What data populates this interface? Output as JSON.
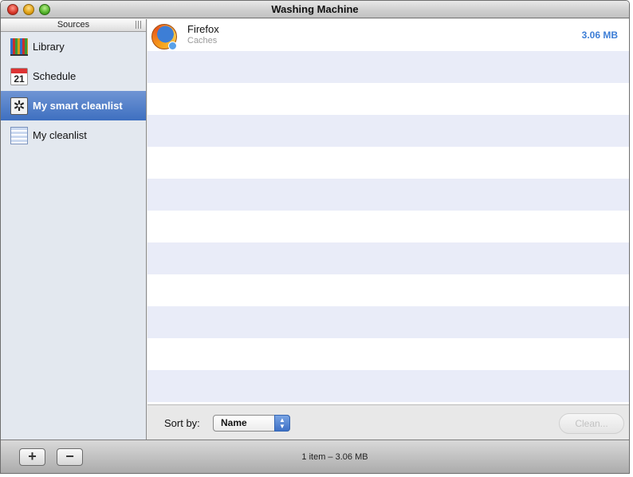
{
  "window": {
    "title": "Washing Machine",
    "traffic_lights": [
      "close",
      "minimize",
      "zoom"
    ]
  },
  "sidebar": {
    "header": "Sources",
    "items": [
      {
        "label": "Library",
        "icon": "library-books-icon"
      },
      {
        "label": "Schedule",
        "icon": "calendar-icon",
        "icon_text": "21"
      },
      {
        "label": "My smart cleanlist",
        "icon": "gear-icon",
        "selected": true
      },
      {
        "label": "My cleanlist",
        "icon": "list-icon"
      }
    ]
  },
  "list": {
    "rows": [
      {
        "name": "Firefox",
        "subtitle": "Caches",
        "size": "3.06 MB",
        "icon": "firefox-icon"
      }
    ]
  },
  "toolbar": {
    "sort_label": "Sort by:",
    "sort_value": "Name",
    "clean_label": "Clean..."
  },
  "bottom_bar": {
    "add_symbol": "+",
    "remove_symbol": "−",
    "status": "1 item – 3.06 MB"
  },
  "colors": {
    "accent": "#3d7ed6",
    "selection": "#4a78c6",
    "stripe": "#e9ecf8"
  }
}
